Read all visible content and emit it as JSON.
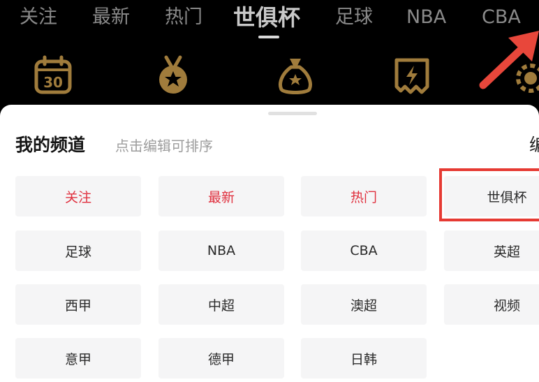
{
  "top_tabs": [
    {
      "label": "关注"
    },
    {
      "label": "最新"
    },
    {
      "label": "热门"
    },
    {
      "label": "世俱杯",
      "active": true
    },
    {
      "label": "足球"
    },
    {
      "label": "NBA"
    },
    {
      "label": "CBA"
    }
  ],
  "shortcut_icons": [
    {
      "name": "calendar-30-icon",
      "label": "30"
    },
    {
      "name": "medal-icon"
    },
    {
      "name": "money-bag-icon"
    },
    {
      "name": "lightning-ticket-icon"
    },
    {
      "name": "gear-icon"
    }
  ],
  "colors": {
    "accent_gold": "#a07c3c",
    "fixed_channel_red": "#e0313f",
    "highlight_red": "#e63a33",
    "arrow_red": "#e8473b"
  },
  "channels": {
    "title": "我的频道",
    "hint": "点击编辑可排序",
    "edit_label": "编",
    "items": [
      {
        "label": "关注",
        "fixed": true
      },
      {
        "label": "最新",
        "fixed": true
      },
      {
        "label": "热门",
        "fixed": true
      },
      {
        "label": "世俱杯",
        "fixed": false,
        "highlighted": true
      },
      {
        "label": "足球",
        "fixed": false
      },
      {
        "label": "NBA",
        "fixed": false
      },
      {
        "label": "CBA",
        "fixed": false
      },
      {
        "label": "英超",
        "fixed": false
      },
      {
        "label": "西甲",
        "fixed": false
      },
      {
        "label": "中超",
        "fixed": false
      },
      {
        "label": "澳超",
        "fixed": false
      },
      {
        "label": "视频",
        "fixed": false
      },
      {
        "label": "意甲",
        "fixed": false
      },
      {
        "label": "德甲",
        "fixed": false
      },
      {
        "label": "日韩",
        "fixed": false
      }
    ]
  }
}
